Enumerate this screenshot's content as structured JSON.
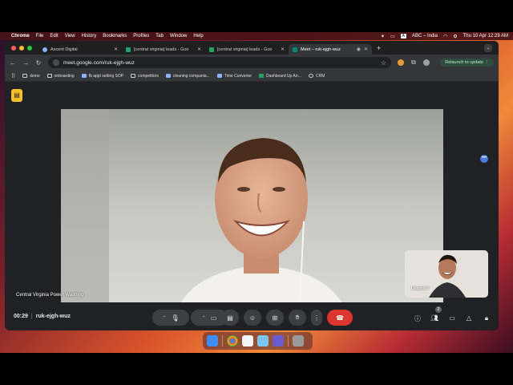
{
  "menubar": {
    "app": "Chrome",
    "items": [
      "File",
      "Edit",
      "View",
      "History",
      "Bookmarks",
      "Profiles",
      "Tab",
      "Window",
      "Help"
    ],
    "input_source": "ABC – India",
    "clock": "Thu 10 Apr  12:29 AM"
  },
  "tabs": [
    {
      "title": "Ascent Digital",
      "favicon": "circle-icon",
      "active": false
    },
    {
      "title": "[central virginia] leads - Goo",
      "favicon": "sheets-icon",
      "active": false
    },
    {
      "title": "[central virginia] leads - Goo",
      "favicon": "sheets-icon",
      "active": false
    },
    {
      "title": "Meet – ruk-ejgh-wuz",
      "favicon": "meet-icon",
      "active": true
    }
  ],
  "toolbar": {
    "url": "meet.google.com/ruk-ejgh-wuz",
    "relaunch_label": "Relaunch to update"
  },
  "bookmarks": [
    {
      "label": "demo",
      "icon": "folder-icon"
    },
    {
      "label": "onboarding",
      "icon": "folder-icon"
    },
    {
      "label": "fb appt setting SOP",
      "icon": "docs-icon"
    },
    {
      "label": "competitors",
      "icon": "folder-icon"
    },
    {
      "label": "cleaning compania...",
      "icon": "docs-icon"
    },
    {
      "label": "Time Converter",
      "icon": "clock-icon"
    },
    {
      "label": "Dashboard Up Arr...",
      "icon": "sheets-icon"
    },
    {
      "label": "CRM",
      "icon": "globe-icon"
    }
  ],
  "meet": {
    "main_participant": "Central Virginia Power Washing",
    "pip_participant": "Usama V",
    "time": "00:29",
    "meeting_code": "ruk-ejgh-wuz",
    "participant_count": "2"
  },
  "colors": {
    "hangup": "#dc362e",
    "meet_bg": "#202124",
    "accent_blue": "#8ab4f8"
  }
}
